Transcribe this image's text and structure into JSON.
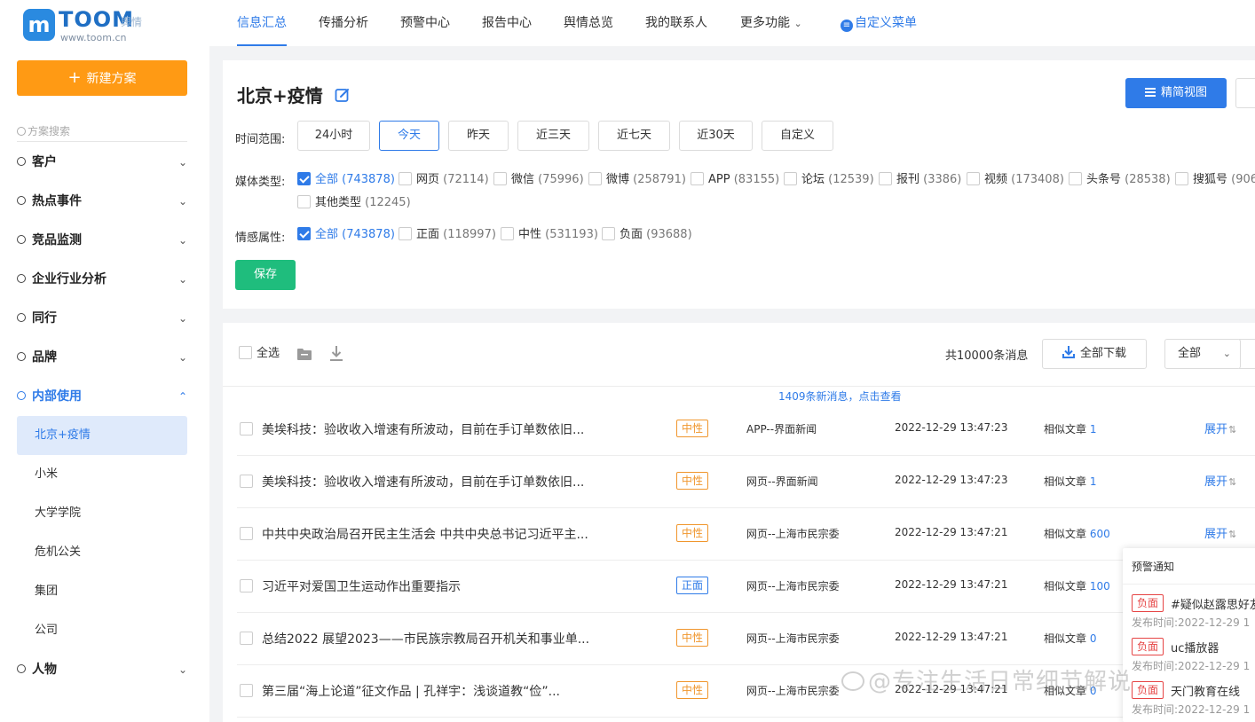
{
  "brand": {
    "name": "TOOM",
    "sub": "舆情",
    "url": "www.toom.cn",
    "logo_letter": "m",
    "accent": "#2f7be8",
    "orange": "#ff9a14",
    "green": "#1fbd7d"
  },
  "sidebar": {
    "new_plan": "新建方案",
    "search_placeholder": "方案搜索",
    "groups": [
      {
        "label": "客户"
      },
      {
        "label": "热点事件"
      },
      {
        "label": "竞品监测"
      },
      {
        "label": "企业行业分析"
      },
      {
        "label": "同行"
      },
      {
        "label": "品牌"
      },
      {
        "label": "内部使用"
      }
    ],
    "sub_items": [
      "北京+疫情",
      "小米",
      "大学学院",
      "危机公关",
      "集团",
      "公司"
    ],
    "last_group": "人物"
  },
  "topnav": {
    "tabs": [
      "信息汇总",
      "传播分析",
      "预警中心",
      "报告中心",
      "舆情总览",
      "我的联系人",
      "更多功能"
    ],
    "custom_menu": "自定义菜单"
  },
  "filter": {
    "title": "北京+疫情",
    "view_button": "精简视图",
    "time_label": "时间范围:",
    "time_options": [
      "24小时",
      "今天",
      "昨天",
      "近三天",
      "近七天",
      "近30天",
      "自定义"
    ],
    "media_label": "媒体类型:",
    "media": [
      {
        "label": "全部",
        "count": "(743878)"
      },
      {
        "label": "网页",
        "count": "(72114)"
      },
      {
        "label": "微信",
        "count": "(75996)"
      },
      {
        "label": "微博",
        "count": "(258791)"
      },
      {
        "label": "APP",
        "count": "(83155)"
      },
      {
        "label": "论坛",
        "count": "(12539)"
      },
      {
        "label": "报刊",
        "count": "(3386)"
      },
      {
        "label": "视频",
        "count": "(173408)"
      },
      {
        "label": "头条号",
        "count": "(28538)"
      },
      {
        "label": "搜狐号",
        "count": "(906"
      },
      {
        "label": "其他类型",
        "count": "(12245)"
      }
    ],
    "emotion_label": "情感属性:",
    "emotion": [
      {
        "label": "全部",
        "count": "(743878)"
      },
      {
        "label": "正面",
        "count": "(118997)"
      },
      {
        "label": "中性",
        "count": "(531193)"
      },
      {
        "label": "负面",
        "count": "(93688)"
      }
    ],
    "save": "保存"
  },
  "list": {
    "select_all": "全选",
    "total": "共10000条消息",
    "download_all": "全部下载",
    "type_select": "全部",
    "new_msg": "1409条新消息，点击查看",
    "similar_label": "相似文章",
    "expand_label": "展开",
    "rows": [
      {
        "title": "美埃科技：验收收入增速有所波动，目前在手订单数依旧...",
        "sentiment": "中性",
        "source": "APP--界面新闻",
        "time": "2022-12-29 13:47:23",
        "similar": "1",
        "expand": true
      },
      {
        "title": "美埃科技：验收收入增速有所波动，目前在手订单数依旧...",
        "sentiment": "中性",
        "source": "网页--界面新闻",
        "time": "2022-12-29 13:47:23",
        "similar": "1",
        "expand": true
      },
      {
        "title": "中共中央政治局召开民主生活会 中共中央总书记习近平主...",
        "sentiment": "中性",
        "source": "网页--上海市民宗委",
        "time": "2022-12-29 13:47:21",
        "similar": "600",
        "expand": true
      },
      {
        "title": "习近平对爱国卫生运动作出重要指示",
        "sentiment": "正面",
        "source": "网页--上海市民宗委",
        "time": "2022-12-29 13:47:21",
        "similar": "100",
        "expand": false
      },
      {
        "title": "总结2022 展望2023——市民族宗教局召开机关和事业单...",
        "sentiment": "中性",
        "source": "网页--上海市民宗委",
        "time": "2022-12-29 13:47:21",
        "similar": "0",
        "expand": false
      },
      {
        "title": "第三届“海上论道”征文作品 | 孔祥宇：浅谈道教“俭”...",
        "sentiment": "中性",
        "source": "网页--上海市民宗委",
        "time": "2022-12-29 13:47:21",
        "similar": "0",
        "expand": false
      }
    ]
  },
  "alert": {
    "title": "预警通知",
    "items": [
      {
        "tag": "负面",
        "text": "#疑似赵露思好友",
        "time": "发布时间:2022-12-29 1"
      },
      {
        "tag": "负面",
        "text": "uc播放器",
        "time": "发布时间:2022-12-29 1"
      },
      {
        "tag": "负面",
        "text": "天门教育在线",
        "time": "发布时间:2022-12-29 1"
      }
    ]
  },
  "watermark": "@专注生活日常细节解说"
}
